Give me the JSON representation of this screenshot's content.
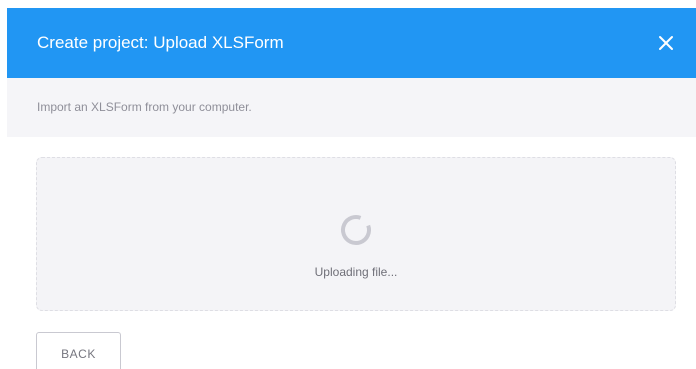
{
  "modal": {
    "title": "Create project: Upload XLSForm",
    "close_icon": "close-icon",
    "subtitle": "Import an XLSForm from your computer.",
    "upload": {
      "status_text": "Uploading file...",
      "spinner_icon": "loading-spinner-icon"
    },
    "back_label": "BACK"
  },
  "colors": {
    "header_background": "#2196f3",
    "header_text": "#ffffff",
    "subheader_background": "#f5f5f8",
    "dropzone_background": "#f4f4f7",
    "dropzone_border": "#dedee4",
    "spinner": "#c9c9d1"
  }
}
